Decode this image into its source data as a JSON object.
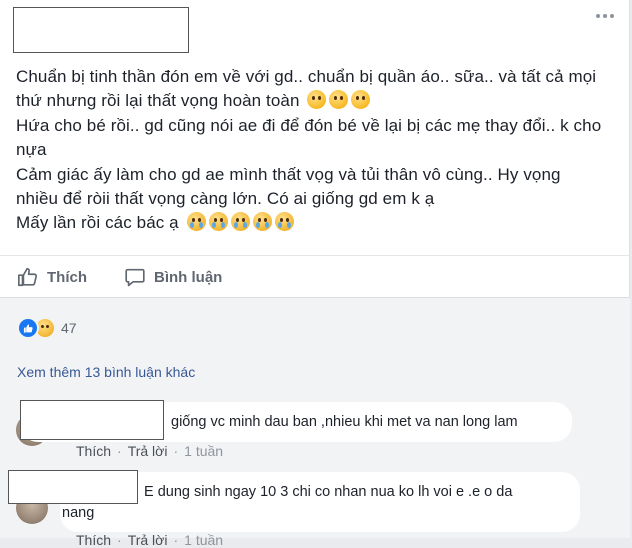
{
  "post": {
    "lines": [
      "Chuẩn bị tinh thần đón em về với gd.. chuẩn bị quần áo.. sữa.. và tất cả mọi",
      "thứ nhưng rồi lại thất vọng hoàn toàn",
      "Hứa cho bé rồi.. gd cũng nói ae đi để đón bé về lại bị các mẹ thay đổi.. k cho",
      "nựa",
      "Cảm giác ấy làm cho gd ae mình thất vọg và tủi thân vô cùng.. Hy vọng",
      "nhiều để ròii thất vọng càng lớn. Có ai giống gd em k ạ",
      "Mấy lần rồi các bác ạ"
    ],
    "emoji_line2": "weary-face-icon",
    "emoji_line7": "crying-face-icon"
  },
  "actions": {
    "like_label": "Thích",
    "comment_label": "Bình luận"
  },
  "reactions": {
    "count": "47"
  },
  "view_more": "Xem thêm 13 bình luận khác",
  "comments": [
    {
      "text": "giống vc minh dau ban ,nhieu khi met va nan long lam",
      "like_label": "Thích",
      "reply_label": "Trả lời",
      "time": "1 tuần"
    },
    {
      "text_line1": "E dung sinh ngay 10 3 chi co nhan nua ko lh voi e .e o da",
      "text_line2": "nang",
      "like_label": "Thích",
      "reply_label": "Trả lời",
      "time": "1 tuần"
    }
  ],
  "colors": {
    "link": "#385898",
    "action_text": "#606770",
    "like_blue": "#1877f2",
    "comment_bg": "#f2f3f5"
  }
}
